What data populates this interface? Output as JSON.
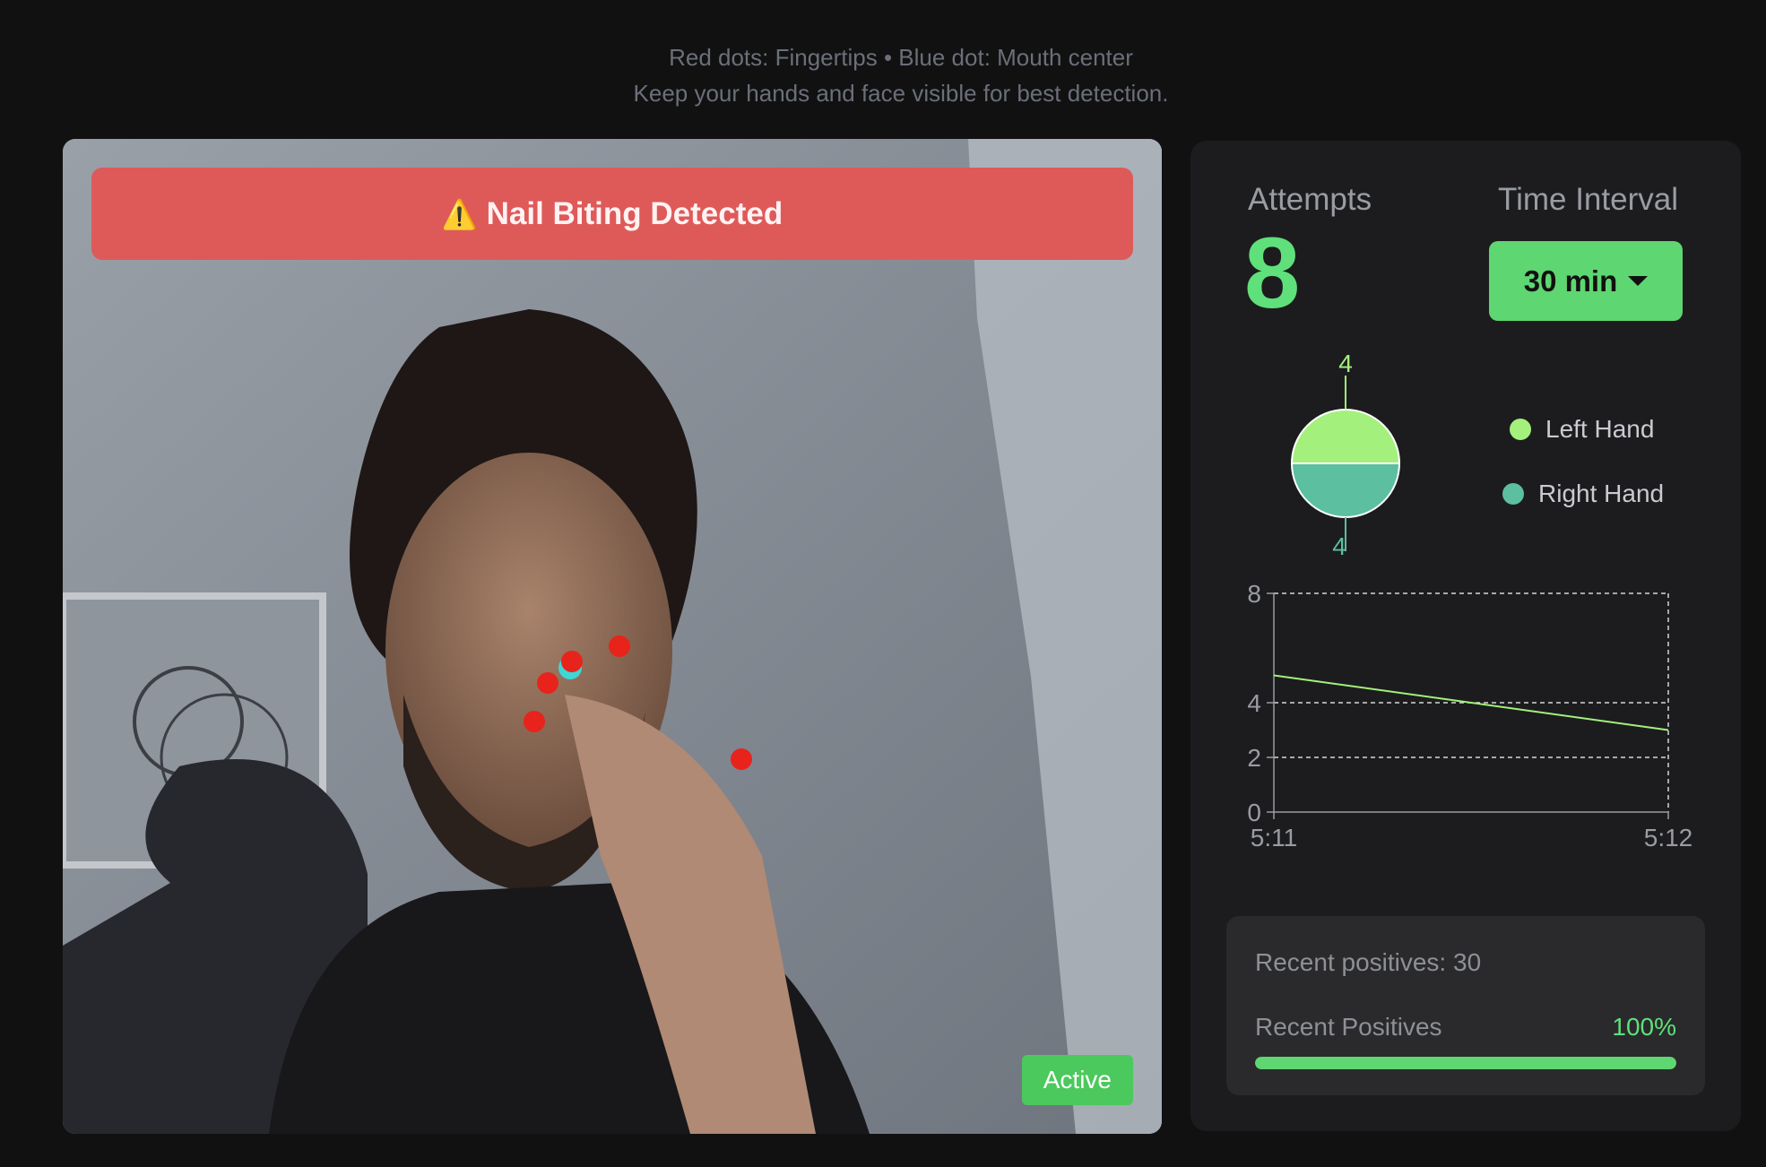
{
  "instructions": {
    "line1": "Red dots: Fingertips • Blue dot: Mouth center",
    "line2": "Keep your hands and face visible for best detection."
  },
  "camera": {
    "alert": {
      "icon": "warning-icon",
      "glyph": "⚠️",
      "text": "Nail Biting Detected",
      "color": "#de5a59"
    },
    "status": "Active",
    "fingertip_color": "#e8231c",
    "mouth_color": "#3fd6d6"
  },
  "stats": {
    "attempts_label": "Attempts",
    "attempts_value": "8",
    "interval_label": "Time Interval",
    "interval_value": "30 min",
    "recent_positives": "Recent positives: 30",
    "progress_label": "Recent Positives",
    "progress_value_text": "100%",
    "progress_fraction": 1.0
  },
  "legend": [
    {
      "label": "Left Hand",
      "color": "#a4f07d"
    },
    {
      "label": "Right Hand",
      "color": "#5bbfa0"
    }
  ],
  "chart_data": [
    {
      "type": "pie",
      "slices": [
        {
          "label": "Left Hand",
          "value": 4,
          "color": "#a4f07d"
        },
        {
          "label": "Right Hand",
          "value": 4,
          "color": "#5bbfa0"
        }
      ],
      "data_labels": [
        "4",
        "4"
      ]
    },
    {
      "type": "line",
      "x_ticks": [
        "5:11",
        "5:12"
      ],
      "y_ticks": [
        "0",
        "2",
        "4",
        "8"
      ],
      "ylim": [
        0,
        8
      ],
      "grid": true,
      "series": [
        {
          "x": [
            "5:11",
            "5:12"
          ],
          "values": [
            5,
            3
          ],
          "color": "#a4f07d"
        }
      ]
    }
  ]
}
